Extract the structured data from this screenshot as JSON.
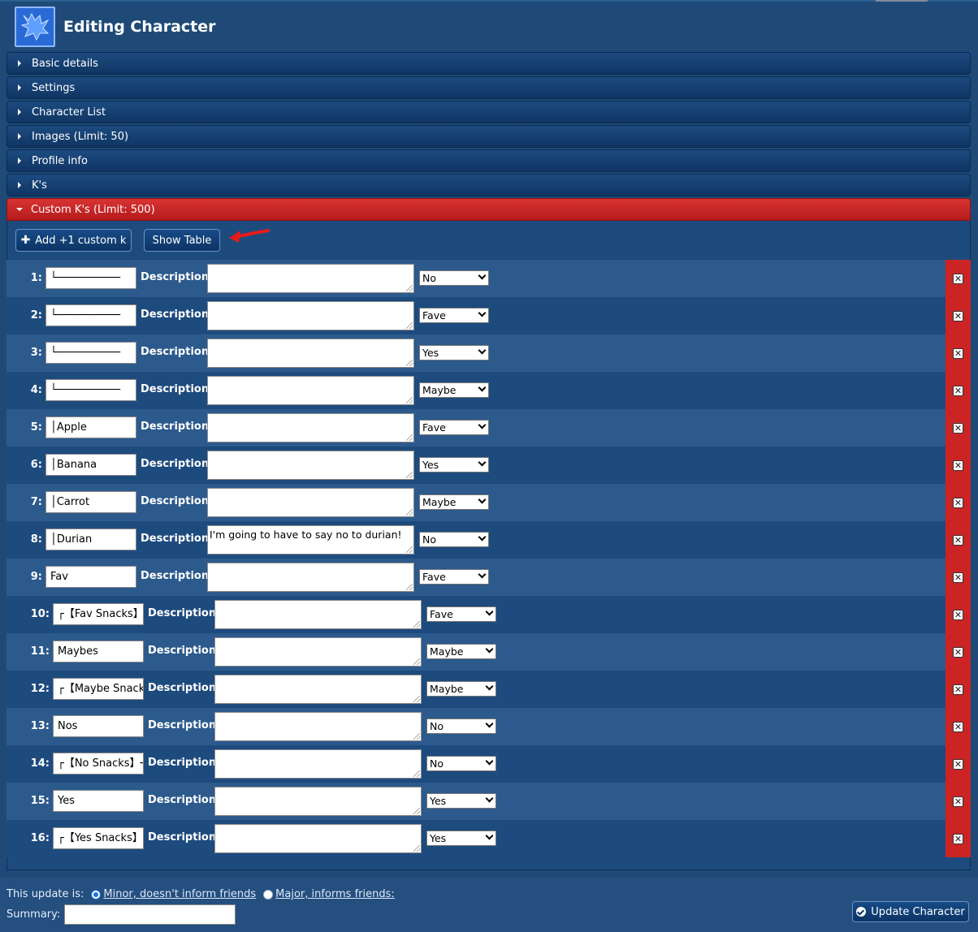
{
  "header": {
    "title": "Editing Character",
    "logo_icon": "wolf-logo-icon"
  },
  "sections": [
    {
      "label": "Basic details"
    },
    {
      "label": "Settings"
    },
    {
      "label": "Character List"
    },
    {
      "label": "Images (Limit: 50)"
    },
    {
      "label": "Profile info"
    },
    {
      "label": "K's"
    },
    {
      "label": "Custom K's (Limit: 500)"
    }
  ],
  "toolbar": {
    "add_label": "Add +1 custom k",
    "show_table_label": "Show Table"
  },
  "description_label": "Description",
  "rows": [
    {
      "num": "1:",
      "name": "└──────────",
      "description": "",
      "option": "No"
    },
    {
      "num": "2:",
      "name": "└──────────",
      "description": "",
      "option": "Fave"
    },
    {
      "num": "3:",
      "name": "└──────────",
      "description": "",
      "option": "Yes"
    },
    {
      "num": "4:",
      "name": "└──────────",
      "description": "",
      "option": "Maybe"
    },
    {
      "num": "5:",
      "name": "│Apple",
      "description": "",
      "option": "Fave"
    },
    {
      "num": "6:",
      "name": "│Banana",
      "description": "",
      "option": "Yes"
    },
    {
      "num": "7:",
      "name": "│Carrot",
      "description": "",
      "option": "Maybe"
    },
    {
      "num": "8:",
      "name": "│Durian",
      "description": "I'm going to have to say no to durian!",
      "option": "No"
    },
    {
      "num": "9:",
      "name": "Fav",
      "description": "",
      "option": "Fave"
    },
    {
      "num": "10:",
      "name": "┌【Fav Snacks】",
      "description": "",
      "option": "Fave"
    },
    {
      "num": "11:",
      "name": "Maybes",
      "description": "",
      "option": "Maybe"
    },
    {
      "num": "12:",
      "name": "┌【Maybe Snack",
      "description": "",
      "option": "Maybe"
    },
    {
      "num": "13:",
      "name": "Nos",
      "description": "",
      "option": "No"
    },
    {
      "num": "14:",
      "name": "┌【No Snacks】┐",
      "description": "",
      "option": "No"
    },
    {
      "num": "15:",
      "name": "Yes",
      "description": "",
      "option": "Yes"
    },
    {
      "num": "16:",
      "name": "┌【Yes Snacks】",
      "description": "",
      "option": "Yes"
    }
  ],
  "footer": {
    "update_is_label": "This update is:",
    "minor_label": "Minor, doesn't inform friends",
    "major_label": "Major, informs friends:",
    "summary_label": "Summary:",
    "summary_value": "",
    "update_button_label": "Update Character"
  },
  "colors": {
    "active_section": "#cc2424",
    "background": "#1f4a77",
    "delete": "#cc2424"
  }
}
